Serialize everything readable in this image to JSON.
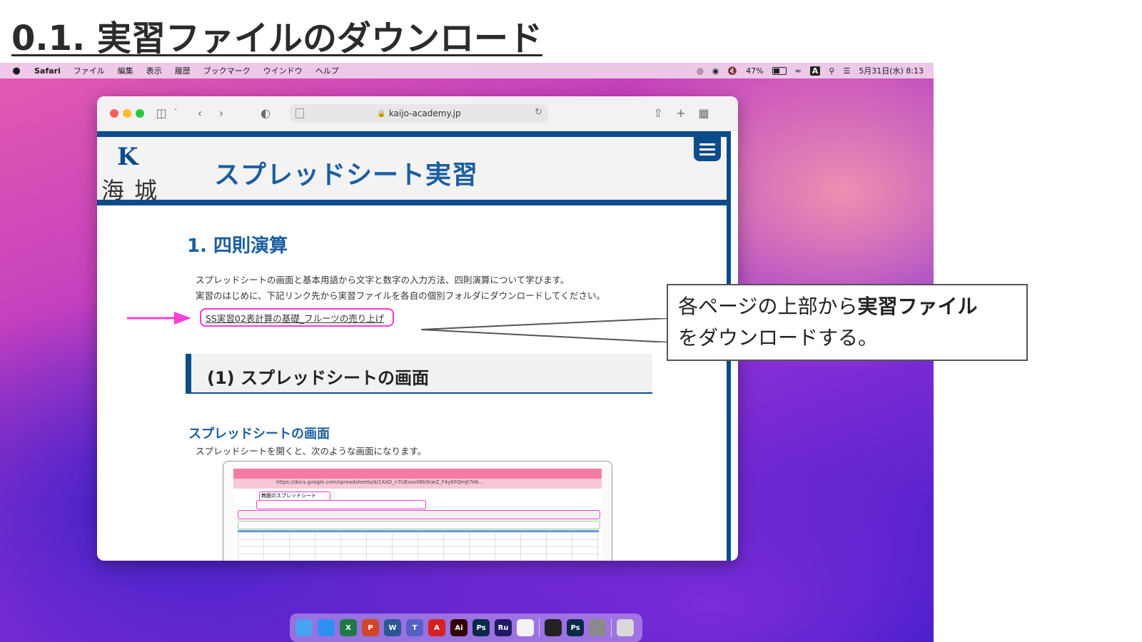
{
  "slide": {
    "title": "0.1. 実習ファイルのダウンロード"
  },
  "menubar": {
    "apple_icon": "apple-logo-icon",
    "app": "Safari",
    "items": [
      "ファイル",
      "編集",
      "表示",
      "履歴",
      "ブックマーク",
      "ウインドウ",
      "ヘルプ"
    ],
    "battery": "47%",
    "datetime": "5月31日(水) 8:13",
    "status_icons": [
      "creative-cloud-icon",
      "vpn-icon",
      "mute-icon",
      "battery-icon",
      "wifi-icon",
      "input-a-icon",
      "search-icon",
      "control-center-icon"
    ]
  },
  "safari": {
    "url": "kaijo-academy.jp",
    "toolbar_icons": [
      "sidebar-icon",
      "back-icon",
      "forward-icon",
      "shield-icon",
      "share-icon",
      "new-tab-icon",
      "tab-overview-icon"
    ]
  },
  "site": {
    "logo_mark": "K",
    "logo_text": "海 城",
    "title": "スプレッドシート実習",
    "heading1": "1. 四則演算",
    "para1": "スプレッドシートの画面と基本用語から文字と数字の入力方法、四則演算について学びます。",
    "para2": "実習のはじめに、下記リンク先から実習ファイルを各自の個別フォルダにダウンロードしてください。",
    "download_link": "SS実習02表計算の基礎_フルーツの売り上げ",
    "section_title": "(1) スプレッドシートの画面",
    "sub_heading": "スプレッドシートの画面",
    "sub_para": "スプレッドシートを開くと、次のような画面になります。"
  },
  "mini_sheet": {
    "url": "https://docs.google.com/spreadsheets/d/1XAD_n7UEsxx0Bb9rjeZ_F4yKFQmJt7Hk...",
    "name": "無題のスプレッドシート"
  },
  "callout": {
    "line1_plain": "各ページの上部から",
    "line1_bold": "実習ファイル",
    "line2": "をダウンロードする。"
  },
  "dock": {
    "apps": [
      {
        "name": "finder",
        "label": "",
        "color": "#4aa3f0"
      },
      {
        "name": "safari",
        "label": "",
        "color": "#2f8ff0"
      },
      {
        "name": "excel",
        "label": "X",
        "color": "#1e7a45"
      },
      {
        "name": "powerpoint",
        "label": "P",
        "color": "#d24726"
      },
      {
        "name": "word",
        "label": "W",
        "color": "#2b5797"
      },
      {
        "name": "teams",
        "label": "T",
        "color": "#5a5fc7"
      },
      {
        "name": "acrobat",
        "label": "A",
        "color": "#d82020"
      },
      {
        "name": "illustrator",
        "label": "Ai",
        "color": "#330000"
      },
      {
        "name": "photoshop",
        "label": "Ps",
        "color": "#0b2a4a"
      },
      {
        "name": "rush",
        "label": "Ru",
        "color": "#1f1a66"
      },
      {
        "name": "textedit",
        "label": "",
        "color": "#f2f2f2"
      },
      {
        "name": "activity-monitor",
        "label": "",
        "color": "#222222"
      },
      {
        "name": "photoshop-2",
        "label": "Ps",
        "color": "#0b2a4a"
      },
      {
        "name": "system-settings",
        "label": "",
        "color": "#8a8a8a"
      },
      {
        "name": "trash",
        "label": "",
        "color": "#d9d9d9"
      }
    ]
  }
}
